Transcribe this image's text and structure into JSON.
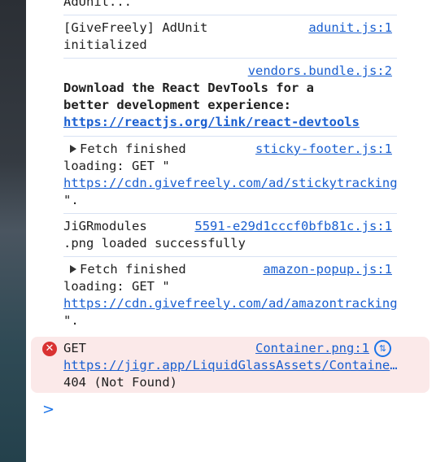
{
  "console": {
    "messages": [
      {
        "lines": [
          "AdUnit..."
        ]
      },
      {
        "source": "adunit.js:1",
        "lines": [
          "[GiveFreely] AdUnit",
          "initialized"
        ]
      },
      {
        "source": "vendors.bundle.js:2",
        "lines": [
          "Download the React DevTools for a",
          "better development experience:"
        ],
        "link": "https://reactjs.org/link/react-devtools"
      },
      {
        "source": "sticky-footer.js:1",
        "lines": [
          "Fetch finished",
          "loading: GET \""
        ],
        "link": "https://cdn.givefreely.com/ad/stickytracking",
        "tail": "\"."
      },
      {
        "source": "5591-e29d1cccf0bfb81c.js:1",
        "lines": [
          "JiGRmodules",
          ".png loaded successfully"
        ]
      },
      {
        "source": "amazon-popup.js:1",
        "lines": [
          "Fetch finished",
          "loading: GET \""
        ],
        "link": "https://cdn.givefreely.com/ad/amazontracking",
        "tail": "\"."
      }
    ],
    "error": {
      "source": "Container.png:1",
      "method": "GET",
      "url": "https://jigr.app/LiquidGlassAssets/Container.png",
      "status": "404 (Not Found)",
      "icon": "error-x-icon",
      "network_icon": "network-request-icon"
    },
    "prompt": ">",
    "colors": {
      "link": "#1a5fd0",
      "error_bg": "#fbe9e9",
      "error_icon": "#d93232"
    }
  }
}
